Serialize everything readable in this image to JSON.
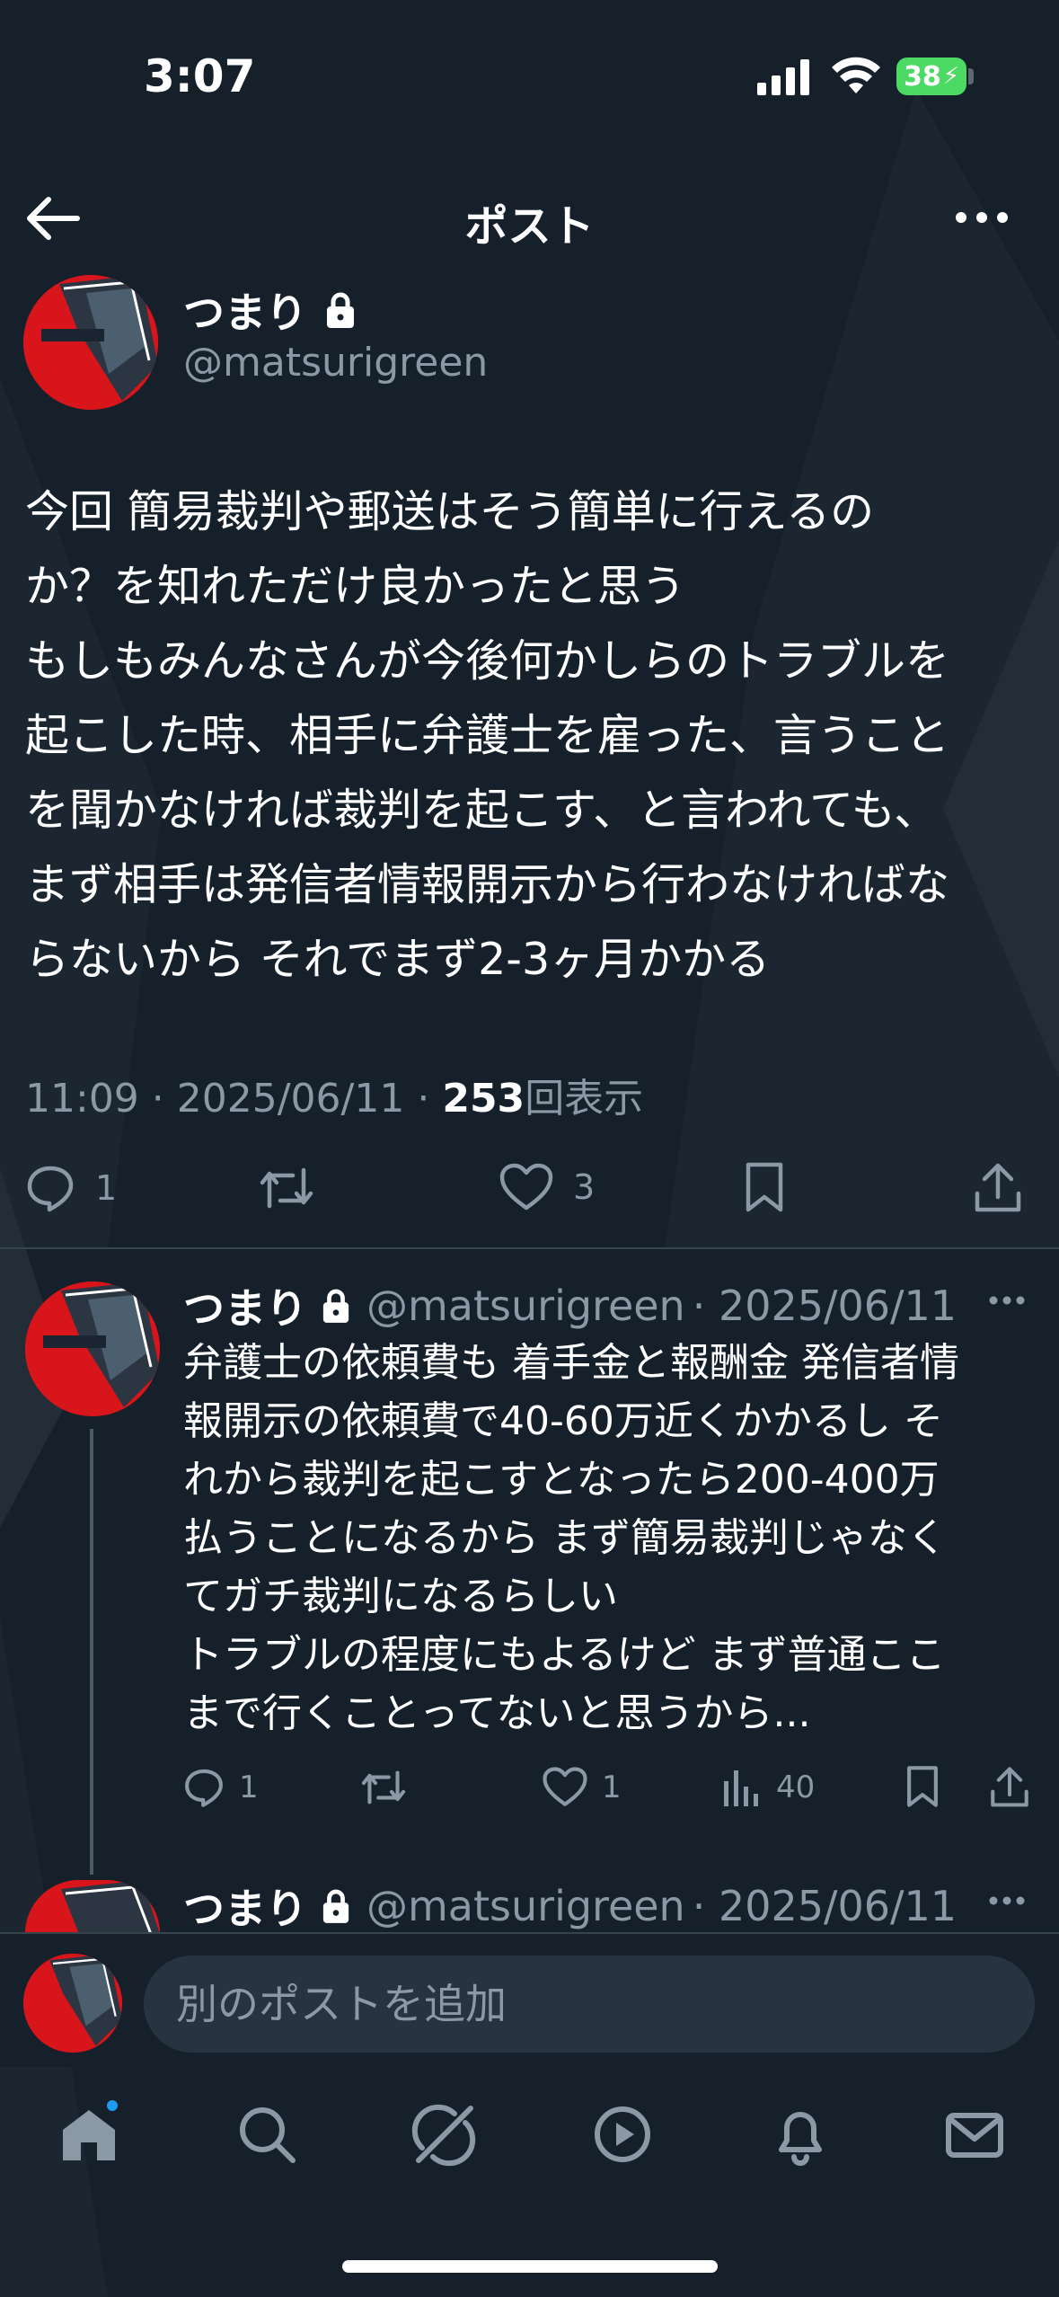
{
  "status_bar": {
    "time": "3:07",
    "battery": "38"
  },
  "header": {
    "title": "ポスト"
  },
  "main_post": {
    "name": "つまり",
    "handle": "@matsurigreen",
    "lines": [
      "今回 簡易裁判や郵送はそう簡単に行えるの",
      "か？を知れただけ良かったと思う",
      "もしもみんなさんが今後何かしらのトラブルを",
      "起こした時、相手に弁護士を雇った、言うこと",
      "を聞かなければ裁判を起こす、と言われても、",
      "まず相手は発信者情報開示から行わなければな",
      "らないから それでまず2-3ヶ月かかる"
    ],
    "meta_prefix": "11:09 · 2025/06/11 · ",
    "views": "253",
    "views_suffix": "回表示",
    "reply_count": "1",
    "like_count": "3"
  },
  "reply_post": {
    "name": "つまり",
    "handle": "@matsurigreen",
    "date": "· 2025/06/11",
    "lines": [
      "弁護士の依頼費も 着手金と報酬金 発信者情",
      "報開示の依頼費で40-60万近くかかるし そ",
      "れから裁判を起こすとなったら200-400万",
      "払うことになるから まず簡易裁判じゃなく",
      "てガチ裁判になるらしい",
      "トラブルの程度にもよるけど まず普通ここ",
      "まで行くことってないと思うから..."
    ],
    "reply_count": "1",
    "like_count": "1",
    "views_count": "40"
  },
  "third_post": {
    "name": "つまり",
    "handle": "@matsurigreen",
    "date": "· 2025/06/11"
  },
  "composer": {
    "placeholder": "別のポストを追加"
  },
  "colors": {
    "background": "#15202b",
    "text": "#e7e9ea",
    "muted": "#8b98a5",
    "accent": "#1d9bf0",
    "avatar": "#d8151b"
  }
}
